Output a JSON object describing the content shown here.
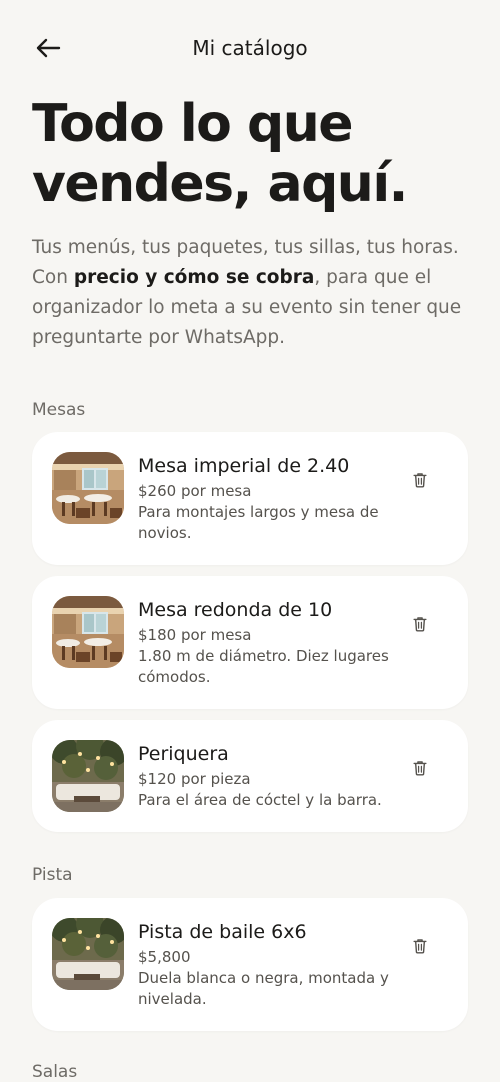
{
  "header": {
    "title": "Mi catálogo"
  },
  "hero": {
    "title_line1": "Todo lo que",
    "title_line2": "vendes, aquí.",
    "intro_part1": "Tus menús, tus paquetes, tus sillas, tus horas. Con ",
    "intro_bold": "precio y cómo se cobra",
    "intro_part2": ", para que el organizador lo meta a su evento sin tener que preguntarte por WhatsApp."
  },
  "sections": [
    {
      "label": "Mesas",
      "items": [
        {
          "name": "Mesa imperial de 2.40",
          "price": "$260 por mesa",
          "description": "Para montajes largos y mesa de novios.",
          "thumb": "dining-hall-image"
        },
        {
          "name": "Mesa redonda de 10",
          "price": "$180 por mesa",
          "description": "1.80 m de diámetro. Diez lugares cómodos.",
          "thumb": "dining-hall-image"
        },
        {
          "name": "Periquera",
          "price": "$120 por pieza",
          "description": "Para el área de cóctel y la barra.",
          "thumb": "garden-lounge-image"
        }
      ]
    },
    {
      "label": "Pista",
      "items": [
        {
          "name": "Pista de baile 6x6",
          "price": "$5,800",
          "description": "Duela blanca o negra, montada y nivelada.",
          "thumb": "garden-lounge-image"
        }
      ]
    },
    {
      "label": "Salas",
      "items": []
    }
  ],
  "icons": {
    "back": "arrow-left-icon",
    "delete": "trash-icon"
  },
  "colors": {
    "background": "#f7f6f3",
    "card": "#ffffff",
    "text": "#1c1b19",
    "muted": "#6e6b66"
  }
}
